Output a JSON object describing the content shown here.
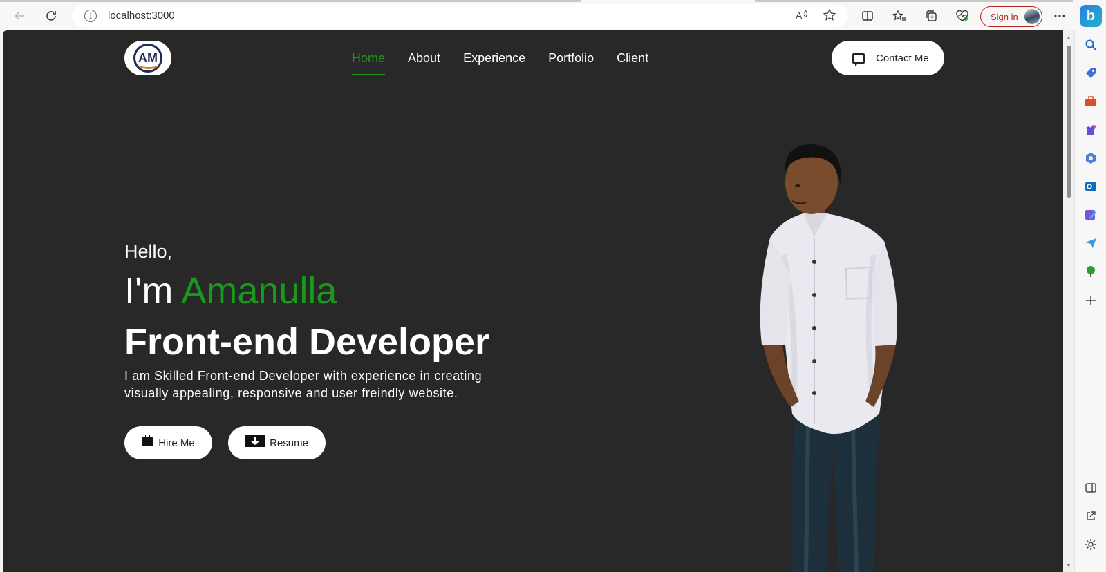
{
  "browser": {
    "url": "localhost:3000",
    "sign_in_label": "Sign in",
    "edge_logo": "b"
  },
  "site": {
    "logo_text": "AM",
    "nav": [
      {
        "label": "Home",
        "active": true
      },
      {
        "label": "About",
        "active": false
      },
      {
        "label": "Experience",
        "active": false
      },
      {
        "label": "Portfolio",
        "active": false
      },
      {
        "label": "Client",
        "active": false
      }
    ],
    "contact_label": "Contact Me"
  },
  "hero": {
    "greeting": "Hello,",
    "intro_prefix": "I'm ",
    "name": "Amanulla",
    "role": "Front-end Developer",
    "description": "I am Skilled Front-end Developer with experience in creating visually appealing, responsive and user freindly website.",
    "hire_label": "Hire Me",
    "resume_label": "Resume"
  },
  "colors": {
    "background": "#282828",
    "accent": "#1a9a1a",
    "sign_in": "#b3261e"
  },
  "icons": {
    "back": "back-arrow-icon",
    "refresh": "refresh-icon",
    "info": "info-icon",
    "read_aloud": "read-aloud-icon",
    "favorite": "star-icon",
    "split": "split-screen-icon",
    "favorites": "favorites-icon",
    "collections": "collections-icon",
    "health": "browser-essentials-icon",
    "more": "more-icon"
  }
}
